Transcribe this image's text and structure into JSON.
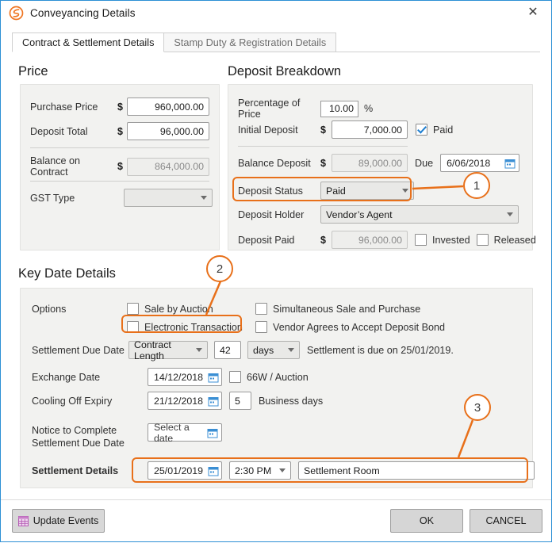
{
  "window": {
    "title": "Conveyancing Details",
    "logo_icon": "swirl-logo-icon",
    "close_icon": "close-icon"
  },
  "tabs": [
    {
      "label": "Contract & Settlement Details",
      "active": true
    },
    {
      "label": "Stamp Duty & Registration Details",
      "active": false
    }
  ],
  "price": {
    "heading": "Price",
    "purchase_price": {
      "label": "Purchase Price",
      "currency": "$",
      "value": "960,000.00"
    },
    "deposit_total": {
      "label": "Deposit Total",
      "currency": "$",
      "value": "96,000.00"
    },
    "balance_on_contract": {
      "label": "Balance on Contract",
      "currency": "$",
      "value": "864,000.00"
    },
    "gst_type": {
      "label": "GST Type",
      "value": ""
    }
  },
  "deposit": {
    "heading": "Deposit Breakdown",
    "percentage_of_price": {
      "label": "Percentage of Price",
      "value": "10.00",
      "unit": "%"
    },
    "initial_deposit": {
      "label": "Initial Deposit",
      "currency": "$",
      "value": "7,000.00",
      "paid_label": "Paid",
      "paid_checked": true
    },
    "balance_deposit": {
      "label": "Balance Deposit",
      "currency": "$",
      "value": "89,000.00",
      "due_label": "Due",
      "due_date": "6/06/2018"
    },
    "deposit_status": {
      "label": "Deposit Status",
      "value": "Paid"
    },
    "deposit_holder": {
      "label": "Deposit Holder",
      "value": "Vendor’s Agent"
    },
    "deposit_paid": {
      "label": "Deposit Paid",
      "currency": "$",
      "value": "96,000.00",
      "invested_label": "Invested",
      "invested_checked": false,
      "released_label": "Released",
      "released_checked": false
    }
  },
  "key_dates": {
    "heading": "Key Date Details",
    "options_label": "Options",
    "options": [
      {
        "label": "Sale by Auction",
        "checked": false
      },
      {
        "label": "Simultaneous Sale and Purchase",
        "checked": false
      },
      {
        "label": "Electronic Transaction",
        "checked": false
      },
      {
        "label": "Vendor Agrees to Accept Deposit Bond",
        "checked": false
      }
    ],
    "settlement_due_date": {
      "label": "Settlement Due Date",
      "basis": "Contract Length",
      "amount": "42",
      "unit": "days",
      "note": "Settlement is due on 25/01/2019."
    },
    "exchange_date": {
      "label": "Exchange Date",
      "value": "14/12/2018",
      "checkbox_label": "66W / Auction",
      "checked": false
    },
    "cooling_off_expiry": {
      "label": "Cooling Off Expiry",
      "value": "21/12/2018",
      "days": "5",
      "days_label": "Business days"
    },
    "notice_to_complete": {
      "label_line1": "Notice to Complete",
      "label_line2": "Settlement Due Date",
      "value": "Select a date"
    },
    "settlement_details": {
      "label": "Settlement Details",
      "date": "25/01/2019",
      "time": "2:30 PM",
      "place": "Settlement Room"
    }
  },
  "footer": {
    "update_events": {
      "label": "Update Events",
      "icon": "calendar-grid-icon"
    },
    "ok": "OK",
    "cancel": "CANCEL"
  },
  "callouts": [
    {
      "number": "1"
    },
    {
      "number": "2"
    },
    {
      "number": "3"
    }
  ],
  "colors": {
    "accent": "#e8701a",
    "window_border": "#2d8fd5",
    "panel_bg": "#f2f2f0",
    "checkbox_tick": "#1e7fd0"
  }
}
